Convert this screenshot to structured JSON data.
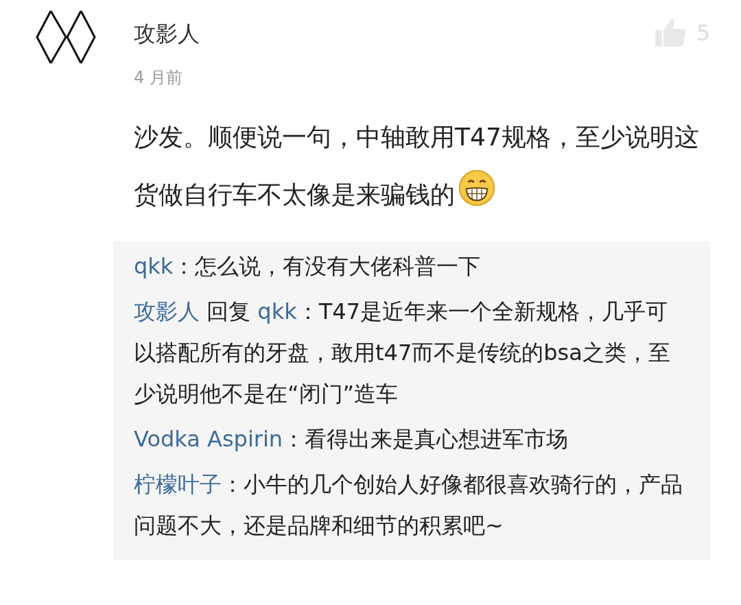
{
  "comment": {
    "author": "攻影人",
    "time": "4 月前",
    "likes": "5",
    "text": "沙发。顺便说一句，中轴敢用T47规格，至少说明这货做自行车不太像是来骗钱的"
  },
  "replies": [
    {
      "author": "qkk",
      "separator": "：",
      "text": "怎么说，有没有大佬科普一下"
    },
    {
      "author": "攻影人",
      "reply_word": "回复",
      "reply_to": "qkk",
      "separator": "：",
      "text": "T47是近年来一个全新规格，几乎可以搭配所有的牙盘，敢用t47而不是传统的bsa之类，至少说明他不是在“闭门”造车"
    },
    {
      "author": "Vodka Aspirin",
      "separator": "：",
      "text": "看得出来是真心想进军市场"
    },
    {
      "author": "柠檬叶子",
      "separator": "：",
      "text": "小牛的几个创始人好像都很喜欢骑行的，产品问题不大，还是品牌和细节的积累吧~"
    }
  ]
}
